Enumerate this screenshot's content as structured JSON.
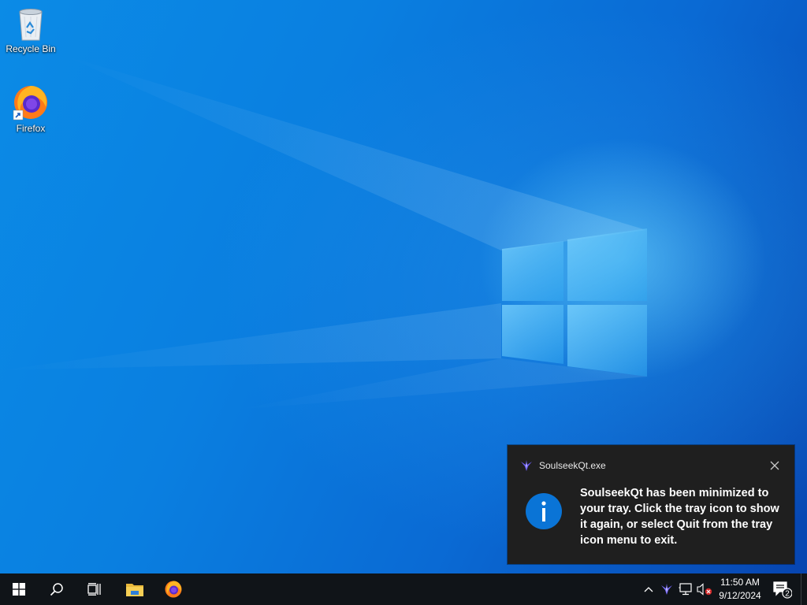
{
  "desktop": {
    "icons": [
      {
        "label": "Recycle Bin",
        "icon": "recycle-bin-icon"
      },
      {
        "label": "Firefox",
        "icon": "firefox-icon"
      }
    ]
  },
  "notification": {
    "app_name": "SoulseekQt.exe",
    "app_icon": "soulseek-bird-icon",
    "info_icon": "info-icon",
    "message": "SoulseekQt has been minimized to your tray. Click the tray icon to show it again, or select Quit from the tray icon menu to exit.",
    "close_icon": "close-icon"
  },
  "taskbar": {
    "start_icon": "windows-start-icon",
    "search_icon": "search-icon",
    "task_view_icon": "task-view-icon",
    "pinned": [
      {
        "name": "File Explorer",
        "icon": "file-explorer-icon"
      },
      {
        "name": "Firefox",
        "icon": "firefox-icon"
      }
    ],
    "tray": {
      "icons": [
        "chevron-up-icon",
        "soulseek-tray-icon",
        "network-icon",
        "volume-muted-icon"
      ],
      "time": "11:50 AM",
      "date": "9/12/2024",
      "notification_count": "2"
    }
  },
  "colors": {
    "taskbar": "#101418",
    "toast_background": "#1f1f1f",
    "info_blue": "#0a74d6",
    "soulseek_purple": "#6a5cf0"
  }
}
